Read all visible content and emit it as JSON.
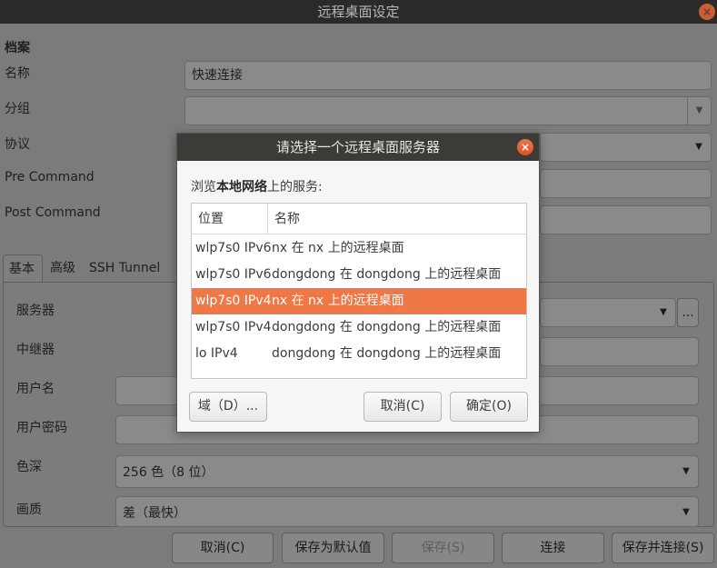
{
  "window": {
    "title": "远程桌面设定",
    "close": "×"
  },
  "profile": {
    "section": "档案",
    "name_label": "名称",
    "name_value": "快速连接",
    "group_label": "分组",
    "group_value": "",
    "protocol_label": "协议",
    "precommand_label": "Pre Command",
    "postcommand_label": "Post Command"
  },
  "tabs": [
    "基本",
    "高级",
    "SSH Tunnel"
  ],
  "basic": {
    "server_label": "服务器",
    "server_browse": "...",
    "repeater_label": "中继器",
    "username_label": "用户名",
    "password_label": "用户密码",
    "color_label": "色深",
    "color_value": "256 色（8 位）",
    "quality_label": "画质",
    "quality_value": "差（最快）"
  },
  "footer": {
    "cancel": "取消(C)",
    "save_default": "保存为默认值",
    "save": "保存(S)",
    "connect": "连接",
    "save_connect": "保存并连接(S)"
  },
  "dialog": {
    "title": "请选择一个远程桌面服务器",
    "close": "×",
    "browse_prefix": "浏览",
    "browse_bold": "本地网络",
    "browse_suffix": "上的服务:",
    "columns": [
      "位置",
      "名称"
    ],
    "rows": [
      {
        "location": "wlp7s0 IPv6",
        "name": "nx 在 nx 上的远程桌面",
        "selected": false
      },
      {
        "location": "wlp7s0 IPv6",
        "name": "dongdong 在 dongdong 上的远程桌面",
        "selected": false
      },
      {
        "location": "wlp7s0 IPv4",
        "name": "nx 在 nx 上的远程桌面",
        "selected": true
      },
      {
        "location": "wlp7s0 IPv4",
        "name": "dongdong 在 dongdong 上的远程桌面",
        "selected": false
      },
      {
        "location": "lo IPv4",
        "name": "dongdong 在 dongdong 上的远程桌面",
        "selected": false
      }
    ],
    "domain_button": "域（D）...",
    "cancel_button": "取消(C)",
    "ok_button": "确定(O)"
  },
  "colors": {
    "selection": "#f07746",
    "close": "#e95420"
  }
}
